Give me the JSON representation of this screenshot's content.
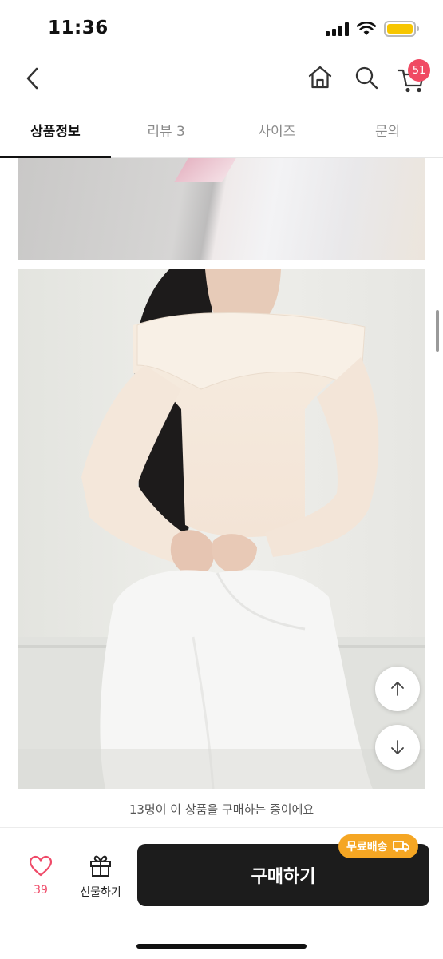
{
  "status_bar": {
    "time": "11:36",
    "battery_level": 1.0,
    "battery_color": "#f7c600"
  },
  "header": {
    "back_icon": "chevron-left-icon",
    "home_icon": "home-icon",
    "search_icon": "search-icon",
    "cart_icon": "cart-icon",
    "cart_count": "51",
    "badge_color": "#f04a63"
  },
  "tabs": [
    {
      "label": "상품정보",
      "active": true
    },
    {
      "label": "리뷰 3",
      "active": false
    },
    {
      "label": "사이즈",
      "active": false
    },
    {
      "label": "문의",
      "active": false
    }
  ],
  "notice": {
    "text": "13명이 이 상품을 구매하는 중이에요"
  },
  "bottom_bar": {
    "like_count": "39",
    "gift_label": "선물하기",
    "buy_label": "구매하기",
    "free_shipping_label": "무료배송",
    "accent_color": "#f5a623",
    "like_color": "#ef4a68"
  }
}
